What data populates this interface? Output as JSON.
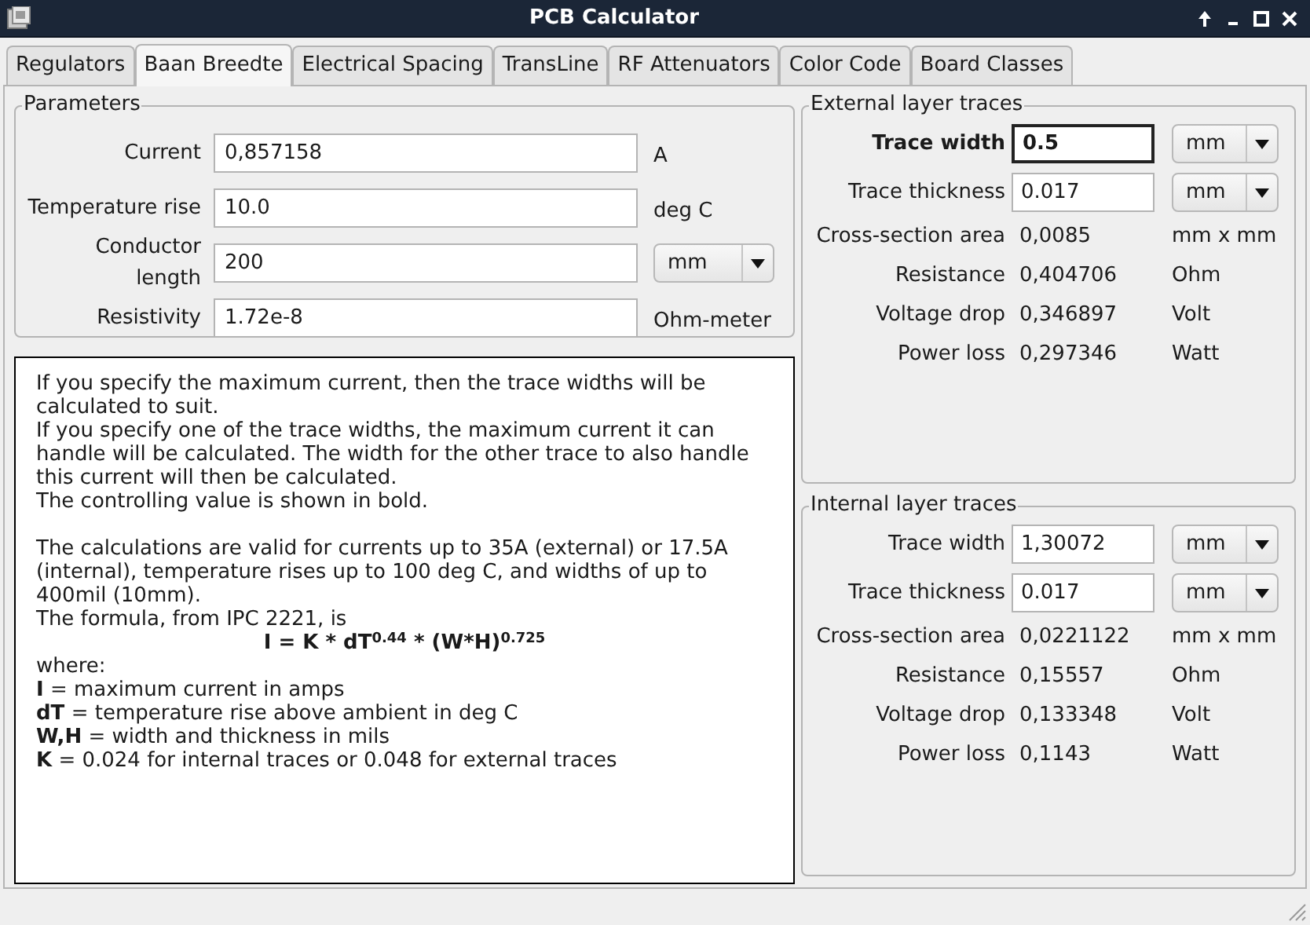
{
  "window": {
    "title": "PCB Calculator"
  },
  "tabs": [
    {
      "label": "Regulators",
      "selected": false
    },
    {
      "label": "Baan Breedte",
      "selected": true
    },
    {
      "label": "Electrical Spacing",
      "selected": false
    },
    {
      "label": "TransLine",
      "selected": false
    },
    {
      "label": "RF Attenuators",
      "selected": false
    },
    {
      "label": "Color Code",
      "selected": false
    },
    {
      "label": "Board Classes",
      "selected": false
    }
  ],
  "parameters": {
    "title": "Parameters",
    "rows": [
      {
        "kind": "unit",
        "label": "Current",
        "value": "0,857158",
        "unit": "A"
      },
      {
        "kind": "unit",
        "label": "Temperature rise",
        "value": "10.0",
        "unit": "deg C"
      },
      {
        "kind": "select",
        "label": "Conductor length",
        "value": "200",
        "unit": "mm"
      },
      {
        "kind": "unit",
        "label": "Resistivity",
        "value": "1.72e-8",
        "unit": "Ohm-meter"
      }
    ]
  },
  "help": {
    "sections": [
      [
        {
          "kind": "text",
          "text": "If you specify the maximum current, then the trace widths will be calculated to suit."
        },
        {
          "kind": "text",
          "text": "If you specify one of the trace widths, the maximum current it can handle will be calculated. The width for the other trace to also handle this current will then be calculated."
        },
        {
          "kind": "text",
          "text": "The controlling value is shown in bold."
        }
      ],
      [
        {
          "kind": "text",
          "text": "The calculations are valid for currents up to 35A (external) or 17.5A (internal), temperature rises up to 100 deg C, and widths of up to 400mil (10mm)."
        },
        {
          "kind": "text",
          "text": "The formula, from IPC 2221, is"
        },
        {
          "kind": "formula",
          "text": "I = K * dT$^{0.44}$ * (W*H)$^{0.725}$"
        },
        {
          "kind": "text",
          "text": "where:"
        },
        {
          "kind": "text",
          "text": "**I** = maximum current in amps"
        },
        {
          "kind": "text",
          "text": "**dT** = temperature rise above ambient in deg C"
        },
        {
          "kind": "text",
          "text": "**W,H** = width and thickness in mils"
        },
        {
          "kind": "text",
          "text": "**K** = 0.024 for internal traces or 0.048 for external traces"
        }
      ]
    ]
  },
  "traces": [
    {
      "title": "External layer traces",
      "rows": [
        {
          "kind": "input",
          "label": "Trace width",
          "value": "0.5",
          "unit": "mm",
          "controlling": true,
          "focused": true
        },
        {
          "kind": "input",
          "label": "Trace thickness",
          "value": "0.017",
          "unit": "mm",
          "controlling": false,
          "focused": false
        },
        {
          "kind": "readout",
          "label": "Cross-section area",
          "value": "0,0085",
          "unit": "mm x mm"
        },
        {
          "kind": "readout",
          "label": "Resistance",
          "value": "0,404706",
          "unit": "Ohm"
        },
        {
          "kind": "readout",
          "label": "Voltage drop",
          "value": "0,346897",
          "unit": "Volt"
        },
        {
          "kind": "readout",
          "label": "Power loss",
          "value": "0,297346",
          "unit": "Watt"
        }
      ]
    },
    {
      "title": "Internal layer traces",
      "rows": [
        {
          "kind": "input",
          "label": "Trace width",
          "value": "1,30072",
          "unit": "mm",
          "controlling": false,
          "focused": false
        },
        {
          "kind": "input",
          "label": "Trace thickness",
          "value": "0.017",
          "unit": "mm",
          "controlling": false,
          "focused": false
        },
        {
          "kind": "readout",
          "label": "Cross-section area",
          "value": "0,0221122",
          "unit": "mm x mm"
        },
        {
          "kind": "readout",
          "label": "Resistance",
          "value": "0,15557",
          "unit": "Ohm"
        },
        {
          "kind": "readout",
          "label": "Voltage drop",
          "value": "0,133348",
          "unit": "Volt"
        },
        {
          "kind": "readout",
          "label": "Power loss",
          "value": "0,1143",
          "unit": "Watt"
        }
      ]
    }
  ]
}
